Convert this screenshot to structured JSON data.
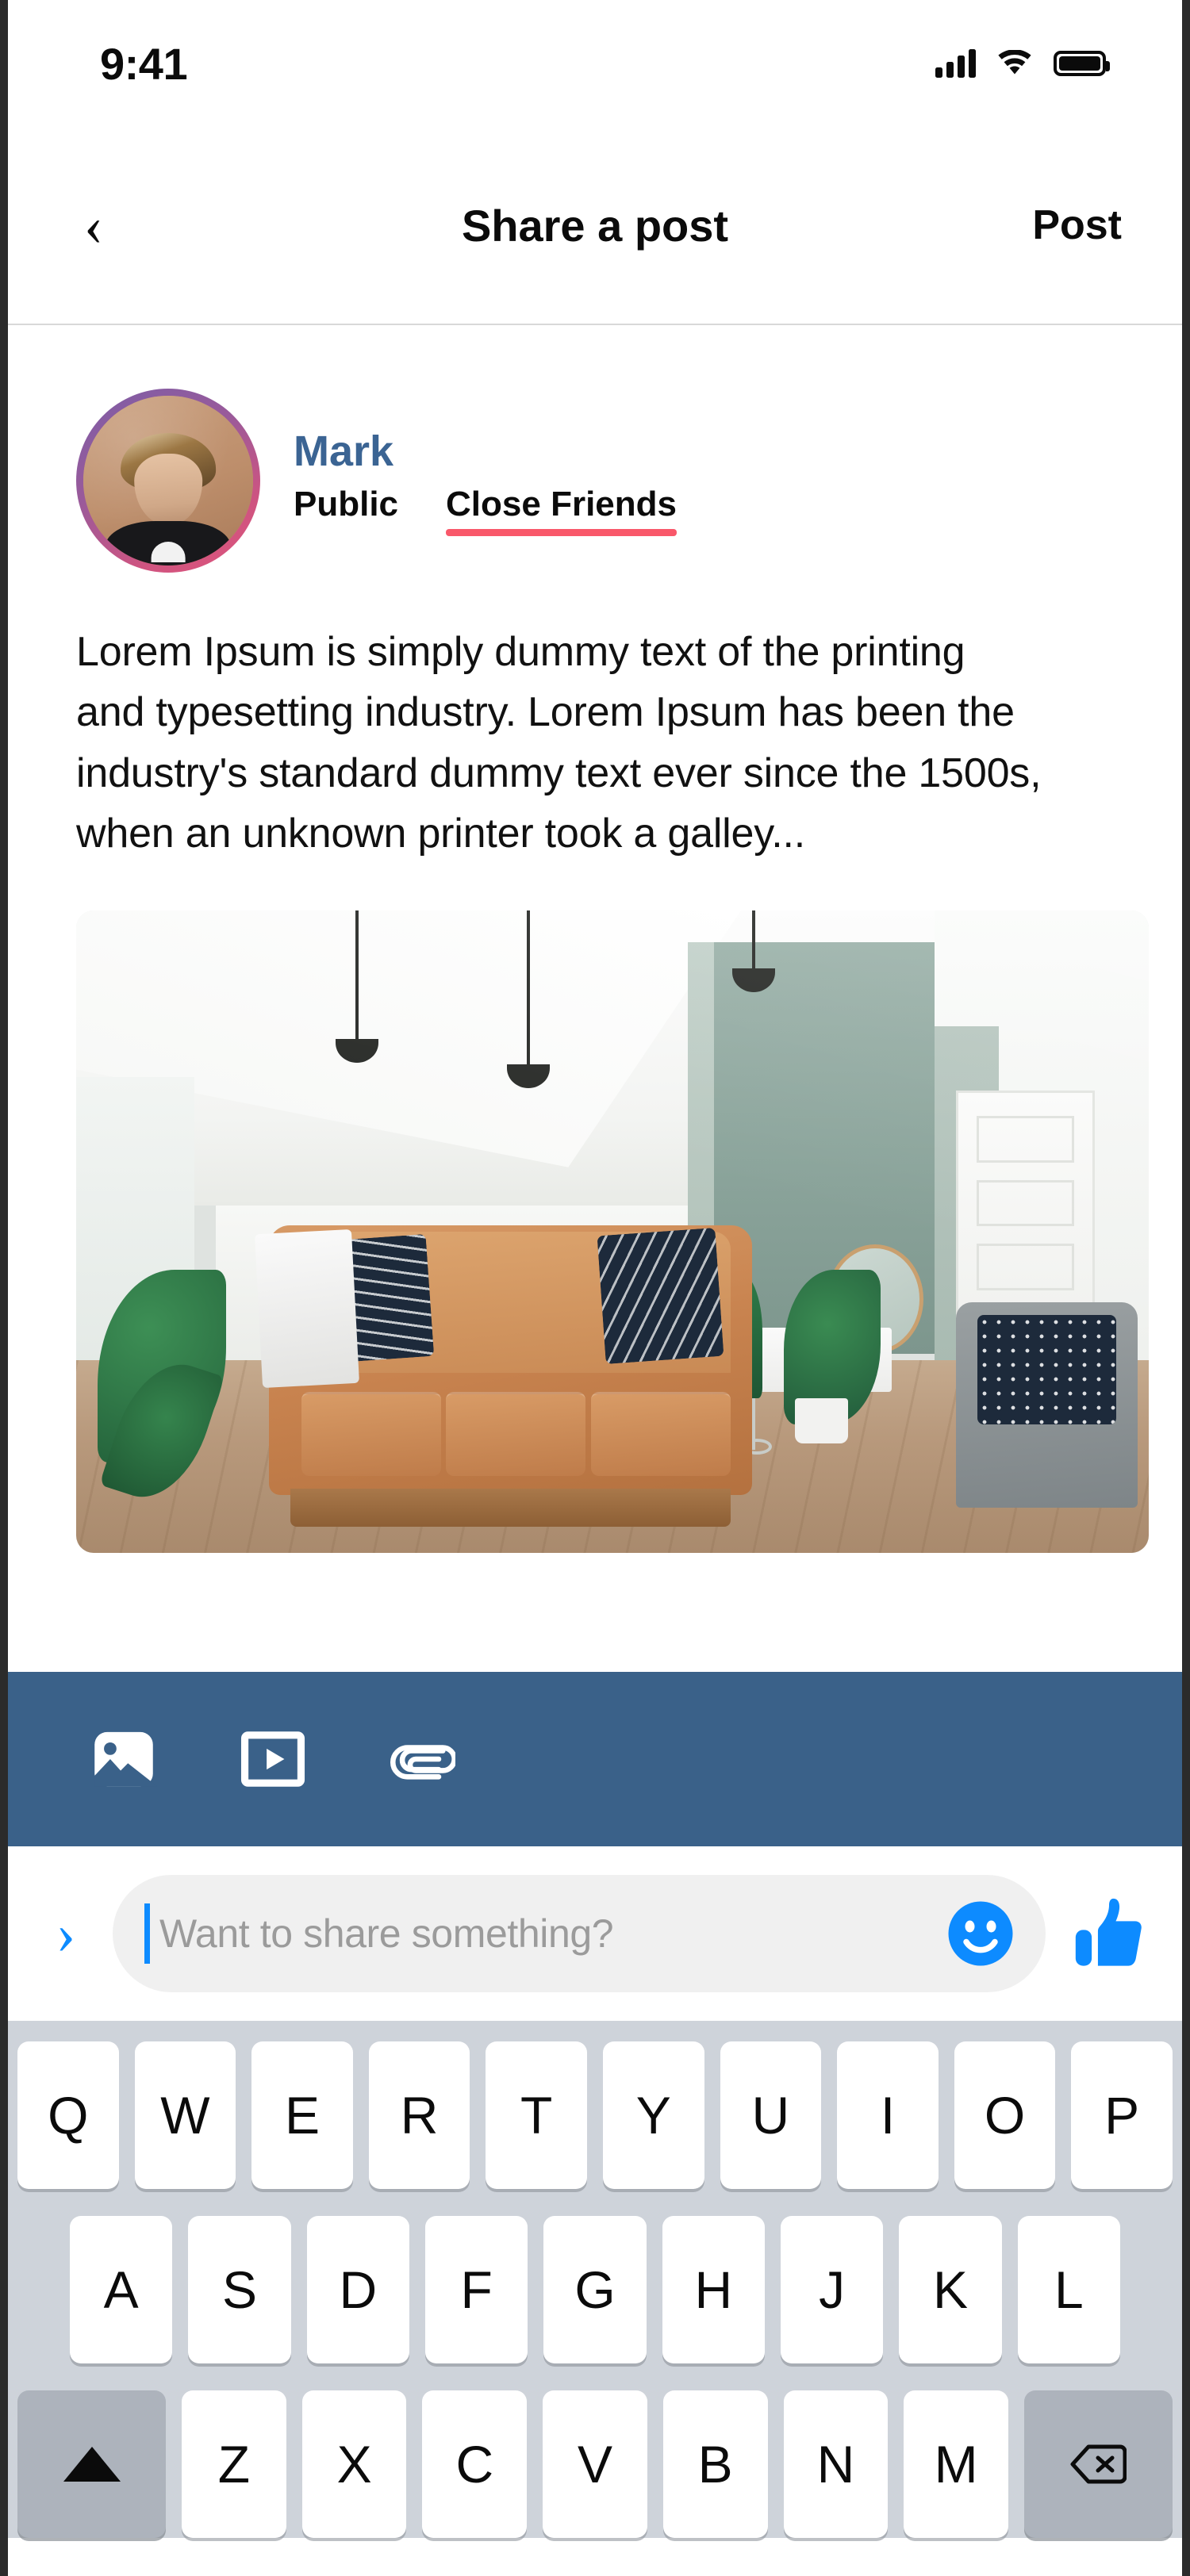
{
  "status_bar": {
    "time": "9:41",
    "icons": [
      "cellular-signal-icon",
      "wifi-icon",
      "battery-icon"
    ]
  },
  "nav": {
    "back_icon": "chevron-left-icon",
    "back_label": "‹",
    "title": "Share a post",
    "post_label": "Post"
  },
  "composer": {
    "avatar": {
      "name": "avatar",
      "alt": "Portrait of a young man with swept blond hair wearing a black shirt",
      "ring_gradient_start": "#7b5ea7",
      "ring_gradient_end": "#e0537b"
    },
    "user_name": "Mark",
    "user_name_color": "#3b6493",
    "audience": [
      {
        "label": "Public",
        "active": false
      },
      {
        "label": "Close Friends",
        "active": true
      }
    ],
    "audience_active_underline_color": "#f9586a",
    "post_text": "Lorem Ipsum is simply dummy text of the printing and typesetting industry. Lorem Ipsum has been the industry's standard dummy text ever since the 1500s, when an unknown printer took a galley...",
    "attached_photo": {
      "name": "attached-photo",
      "alt": "Modern living room interior with a tan leather mid-century sofa, navy patterned pillows, sage green accent wall, pendant lights, houseplants and light wood flooring"
    }
  },
  "toolbar": {
    "background_color": "#3a6189",
    "buttons": [
      {
        "icon": "photo-icon",
        "label": "Photo"
      },
      {
        "icon": "video-icon",
        "label": "Video"
      },
      {
        "icon": "attachment-icon",
        "label": "Attachment"
      }
    ]
  },
  "input_bar": {
    "send_icon": "chevron-right-icon",
    "send_label": "›",
    "placeholder": "Want to share something?",
    "value": "",
    "emoji_icon": "smiley-icon",
    "like_icon": "thumbs-up-icon",
    "accent_color": "#0d8bff"
  },
  "keyboard": {
    "background_color": "#ced3da",
    "rows": [
      [
        "Q",
        "W",
        "E",
        "R",
        "T",
        "Y",
        "U",
        "I",
        "O",
        "P"
      ],
      [
        "A",
        "S",
        "D",
        "F",
        "G",
        "H",
        "J",
        "K",
        "L"
      ],
      [
        "Z",
        "X",
        "C",
        "V",
        "B",
        "N",
        "M"
      ]
    ],
    "shift_key": {
      "icon": "shift-icon",
      "label": "▲"
    },
    "backspace_key": {
      "icon": "backspace-icon",
      "label": "⌫"
    }
  }
}
